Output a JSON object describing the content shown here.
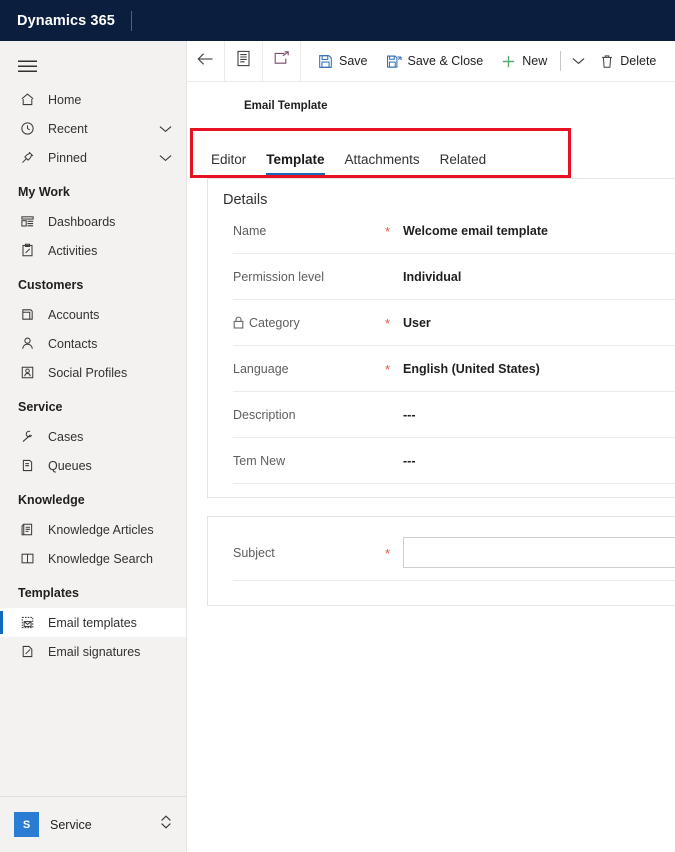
{
  "brand": {
    "title": "Dynamics 365"
  },
  "sidebar": {
    "hamburger_name": "Site map",
    "items": [
      {
        "label": "Home",
        "icon": "home-icon",
        "chevron": false,
        "selected": false
      },
      {
        "label": "Recent",
        "icon": "clock-icon",
        "chevron": true,
        "selected": false
      },
      {
        "label": "Pinned",
        "icon": "pin-icon",
        "chevron": true,
        "selected": false
      }
    ],
    "groups": [
      {
        "title": "My Work",
        "items": [
          {
            "label": "Dashboards",
            "icon": "dashboard-icon",
            "selected": false
          },
          {
            "label": "Activities",
            "icon": "activities-icon",
            "selected": false
          }
        ]
      },
      {
        "title": "Customers",
        "items": [
          {
            "label": "Accounts",
            "icon": "accounts-icon",
            "selected": false
          },
          {
            "label": "Contacts",
            "icon": "contacts-icon",
            "selected": false
          },
          {
            "label": "Social Profiles",
            "icon": "social-profile-icon",
            "selected": false
          }
        ]
      },
      {
        "title": "Service",
        "items": [
          {
            "label": "Cases",
            "icon": "case-wrench-icon",
            "selected": false
          },
          {
            "label": "Queues",
            "icon": "queue-icon",
            "selected": false
          }
        ]
      },
      {
        "title": "Knowledge",
        "items": [
          {
            "label": "Knowledge Articles",
            "icon": "article-icon",
            "selected": false
          },
          {
            "label": "Knowledge Search",
            "icon": "book-search-icon",
            "selected": false
          }
        ]
      },
      {
        "title": "Templates",
        "items": [
          {
            "label": "Email templates",
            "icon": "email-template-icon",
            "selected": true
          },
          {
            "label": "Email signatures",
            "icon": "signature-icon",
            "selected": false
          }
        ]
      }
    ],
    "app_switcher": {
      "initial": "S",
      "label": "Service",
      "chevron_icon": "chevron-up-down-icon"
    }
  },
  "commandbar": {
    "back_icon": "back-arrow-icon",
    "form_icon": "form-list-icon",
    "popout_icon": "open-in-new-icon",
    "save_label": "Save",
    "save_icon": "save-disk-icon",
    "save_close_label": "Save & Close",
    "save_close_icon": "save-and-close-icon",
    "new_label": "New",
    "new_icon": "plus-icon",
    "overflow_icon": "chevron-down-icon",
    "delete_label": "Delete",
    "delete_icon": "trash-icon",
    "accent_new": "#4aa564"
  },
  "record": {
    "entity_label": "Email Template"
  },
  "tabs": {
    "items": [
      {
        "label": "Editor",
        "active": false
      },
      {
        "label": "Template",
        "active": true
      },
      {
        "label": "Attachments",
        "active": false
      },
      {
        "label": "Related",
        "active": false
      }
    ],
    "active_underline_color": "#1d64b4"
  },
  "annotation": {
    "color": "#e81123",
    "target": "tabs-strip"
  },
  "form": {
    "details_section": {
      "title": "Details",
      "fields": [
        {
          "label": "Name",
          "required": true,
          "locked": false,
          "value": "Welcome email template"
        },
        {
          "label": "Permission level",
          "required": false,
          "locked": false,
          "value": "Individual"
        },
        {
          "label": "Category",
          "required": true,
          "locked": true,
          "value": "User"
        },
        {
          "label": "Language",
          "required": true,
          "locked": false,
          "value": "English (United States)"
        },
        {
          "label": "Description",
          "required": false,
          "locked": false,
          "value": "---"
        },
        {
          "label": "Tem New",
          "required": false,
          "locked": false,
          "value": "---"
        }
      ]
    },
    "subject_section": {
      "label": "Subject",
      "required": true,
      "value": "",
      "placeholder": ""
    }
  }
}
